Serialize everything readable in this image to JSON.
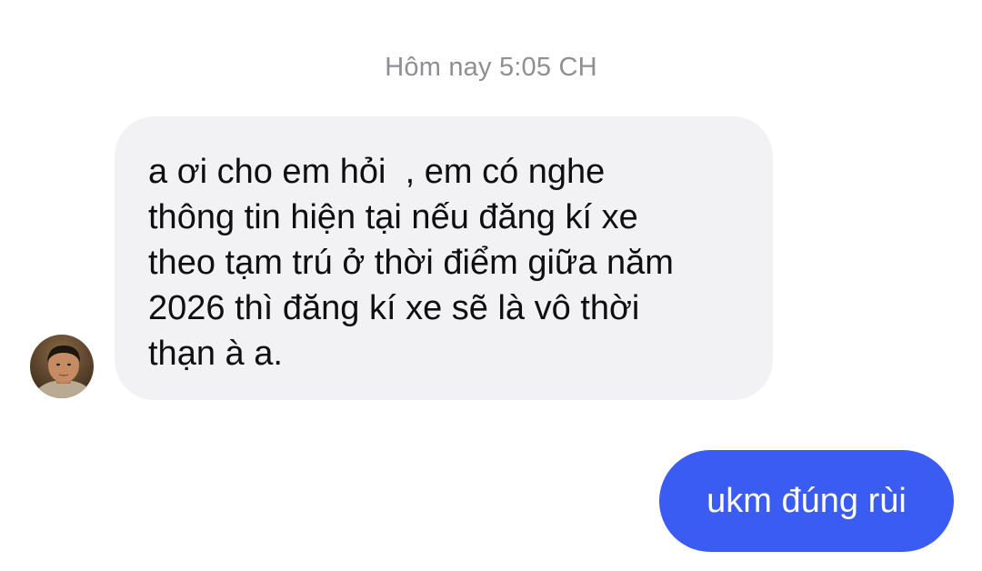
{
  "conversation": {
    "timestamp": "Hôm nay 5:05 CH",
    "incoming_message": {
      "lines": [
        "a ơi cho em hỏi  , em có nghe",
        "thông tin hiện tại nếu đăng kí xe",
        "theo tạm trú ở thời điểm giữa năm",
        "2026 thì đăng kí xe sẽ là vô thời",
        "thạn à a."
      ],
      "bubble_color": "#f2f2f4"
    },
    "outgoing_message": {
      "text": "ukm đúng rùi",
      "bubble_color": "#3a5cf2"
    },
    "avatar": {
      "icon": "user-avatar-photo"
    }
  }
}
